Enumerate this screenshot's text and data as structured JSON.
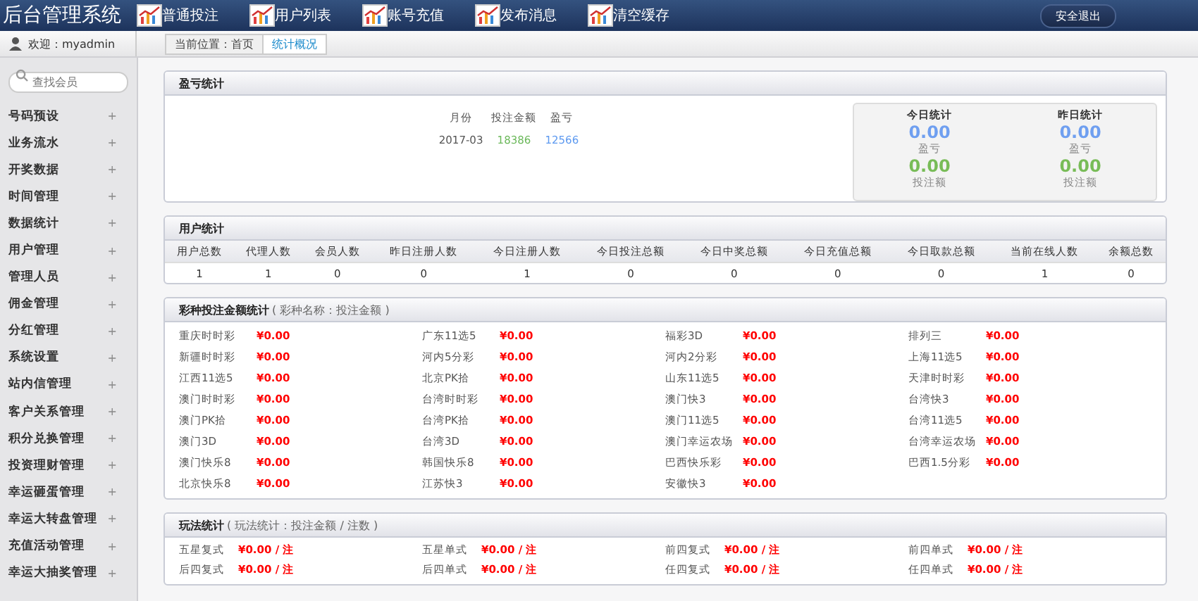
{
  "app": {
    "title": "后台管理系统"
  },
  "nav": [
    {
      "label": "普通投注"
    },
    {
      "label": "用户列表"
    },
    {
      "label": "账号充值"
    },
    {
      "label": "发布消息"
    },
    {
      "label": "清空缓存"
    }
  ],
  "logout": "安全退出",
  "welcome": "欢迎：myadmin",
  "breadcrumb": [
    {
      "label": "当前位置：首页",
      "selected": false
    },
    {
      "label": "统计概况",
      "selected": true
    }
  ],
  "sidebar": {
    "search": {
      "placeholder": "查找会员"
    },
    "items": [
      {
        "label": "号码预设",
        "toggle": "+"
      },
      {
        "label": "业务流水",
        "toggle": "+"
      },
      {
        "label": "开奖数据",
        "toggle": "+"
      },
      {
        "label": "时间管理",
        "toggle": "+"
      },
      {
        "label": "数据统计",
        "toggle": "+"
      },
      {
        "label": "用户管理",
        "toggle": "+"
      },
      {
        "label": "管理人员",
        "toggle": "+"
      },
      {
        "label": "佣金管理",
        "toggle": "+"
      },
      {
        "label": "分红管理",
        "toggle": "+"
      },
      {
        "label": "系统设置",
        "toggle": "+"
      },
      {
        "label": "站内信管理",
        "toggle": "+"
      },
      {
        "label": "客户关系管理",
        "toggle": "+"
      },
      {
        "label": "积分兑换管理",
        "toggle": "+"
      },
      {
        "label": "投资理财管理",
        "toggle": "+"
      },
      {
        "label": "幸运砸蛋管理",
        "toggle": "+"
      },
      {
        "label": "幸运大转盘管理",
        "toggle": "+"
      },
      {
        "label": "充值活动管理",
        "toggle": "+"
      },
      {
        "label": "幸运大抽奖管理",
        "toggle": "+"
      }
    ]
  },
  "profit": {
    "title": "盈亏统计",
    "columns": [
      "月份",
      "投注金额",
      "盈亏"
    ],
    "rows": [
      [
        "2017-03",
        "18386",
        "12566"
      ]
    ],
    "summary": [
      {
        "title": "今日统计",
        "profit": "0.00",
        "profit_label": "盈亏",
        "bet": "0.00",
        "bet_label": "投注额"
      },
      {
        "title": "昨日统计",
        "profit": "0.00",
        "profit_label": "盈亏",
        "bet": "0.00",
        "bet_label": "投注额"
      }
    ]
  },
  "users": {
    "title": "用户统计",
    "columns": [
      "用户总数",
      "代理人数",
      "会员人数",
      "昨日注册人数",
      "今日注册人数",
      "今日投注总额",
      "今日中奖总额",
      "今日充值总额",
      "今日取款总额",
      "当前在线人数",
      "余额总数"
    ],
    "rows": [
      [
        "1",
        "1",
        "0",
        "0",
        "1",
        "0",
        "0",
        "0",
        "0",
        "1",
        "0"
      ]
    ]
  },
  "lottery": {
    "title": "彩种投注金额统计",
    "subtitle": "( 彩种名称：投注金额 )",
    "items": [
      {
        "name": "重庆时时彩",
        "amount": "¥0.00"
      },
      {
        "name": "广东11选5",
        "amount": "¥0.00"
      },
      {
        "name": "福彩3D",
        "amount": "¥0.00"
      },
      {
        "name": "排列三",
        "amount": "¥0.00"
      },
      {
        "name": "新疆时时彩",
        "amount": "¥0.00"
      },
      {
        "name": "河内5分彩",
        "amount": "¥0.00"
      },
      {
        "name": "河内2分彩",
        "amount": "¥0.00"
      },
      {
        "name": "上海11选5",
        "amount": "¥0.00"
      },
      {
        "name": "江西11选5",
        "amount": "¥0.00"
      },
      {
        "name": "北京PK拾",
        "amount": "¥0.00"
      },
      {
        "name": "山东11选5",
        "amount": "¥0.00"
      },
      {
        "name": "天津时时彩",
        "amount": "¥0.00"
      },
      {
        "name": "澳门时时彩",
        "amount": "¥0.00"
      },
      {
        "name": "台湾时时彩",
        "amount": "¥0.00"
      },
      {
        "name": "澳门快3",
        "amount": "¥0.00"
      },
      {
        "name": "台湾快3",
        "amount": "¥0.00"
      },
      {
        "name": "澳门PK拾",
        "amount": "¥0.00"
      },
      {
        "name": "台湾PK拾",
        "amount": "¥0.00"
      },
      {
        "name": "澳门11选5",
        "amount": "¥0.00"
      },
      {
        "name": "台湾11选5",
        "amount": "¥0.00"
      },
      {
        "name": "澳门3D",
        "amount": "¥0.00"
      },
      {
        "name": "台湾3D",
        "amount": "¥0.00"
      },
      {
        "name": "澳门幸运农场",
        "amount": "¥0.00"
      },
      {
        "name": "台湾幸运农场",
        "amount": "¥0.00"
      },
      {
        "name": "澳门快乐8",
        "amount": "¥0.00"
      },
      {
        "name": "韩国快乐8",
        "amount": "¥0.00"
      },
      {
        "name": "巴西快乐彩",
        "amount": "¥0.00"
      },
      {
        "name": "巴西1.5分彩",
        "amount": "¥0.00"
      },
      {
        "name": "北京快乐8",
        "amount": "¥0.00"
      },
      {
        "name": "江苏快3",
        "amount": "¥0.00"
      },
      {
        "name": "安徽快3",
        "amount": "¥0.00"
      }
    ]
  },
  "plays": {
    "title": "玩法统计",
    "subtitle": "( 玩法统计：投注金额 / 注数 )",
    "items": [
      {
        "name": "五星复式",
        "amount": "¥0.00 / 注"
      },
      {
        "name": "五星单式",
        "amount": "¥0.00 / 注"
      },
      {
        "name": "前四复式",
        "amount": "¥0.00 / 注"
      },
      {
        "name": "前四单式",
        "amount": "¥0.00 / 注"
      },
      {
        "name": "后四复式",
        "amount": "¥0.00 / 注"
      },
      {
        "name": "后四单式",
        "amount": "¥0.00 / 注"
      },
      {
        "name": "任四复式",
        "amount": "¥0.00 / 注"
      },
      {
        "name": "任四单式",
        "amount": "¥0.00 / 注"
      }
    ]
  }
}
